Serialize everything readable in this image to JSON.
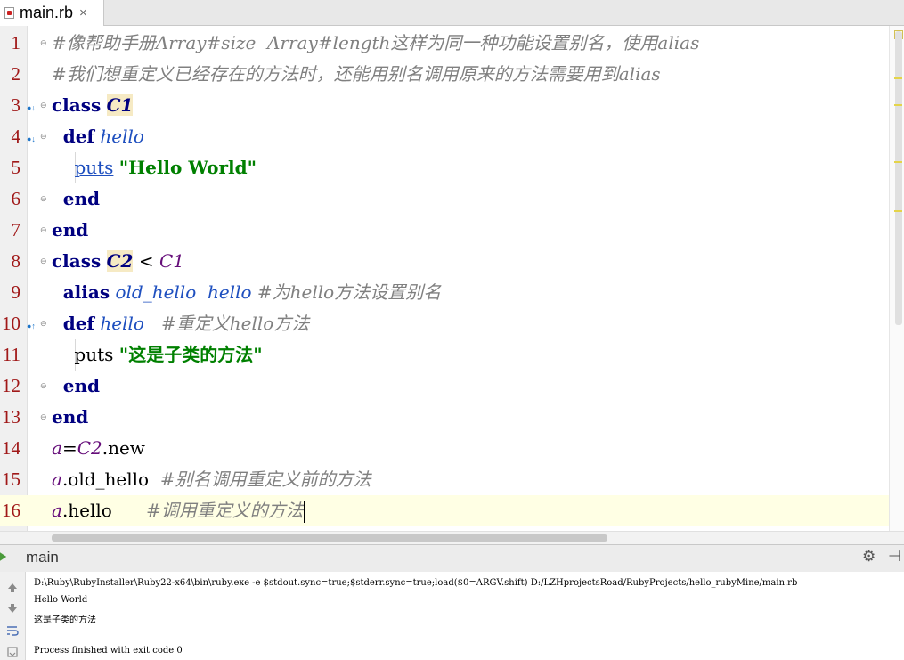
{
  "tab": {
    "file_name": "main.rb",
    "close_glyph": "×"
  },
  "editor": {
    "current_line": 16,
    "lines": [
      {
        "num": "1",
        "code": "#像帮助手册Array#size  Array#length这样为同一种功能设置别名，使用alias"
      },
      {
        "num": "2",
        "code": "#我们想重定义已经存在的方法时，还能用别名调用原来的方法需要用到alias"
      },
      {
        "num": "3",
        "code": "class C1"
      },
      {
        "num": "4",
        "code": "  def hello"
      },
      {
        "num": "5",
        "code": "    puts \"Hello World\""
      },
      {
        "num": "6",
        "code": "  end"
      },
      {
        "num": "7",
        "code": "end"
      },
      {
        "num": "8",
        "code": "class C2 < C1"
      },
      {
        "num": "9",
        "code": "  alias old_hello  hello #为hello方法设置别名"
      },
      {
        "num": "10",
        "code": "  def hello   #重定义hello方法"
      },
      {
        "num": "11",
        "code": "    puts \"这是子类的方法\""
      },
      {
        "num": "12",
        "code": "  end"
      },
      {
        "num": "13",
        "code": "end"
      },
      {
        "num": "14",
        "code": "a=C2.new"
      },
      {
        "num": "15",
        "code": "a.old_hello  #别名调用重定义前的方法"
      },
      {
        "num": "16",
        "code": "a.hello      #调用重定义的方法"
      }
    ]
  },
  "run_panel": {
    "title": "main",
    "gear_glyph": "⚙",
    "pin_glyph": "⊣",
    "toolbar_icons": [
      "arrow-up-icon",
      "arrow-down-icon",
      "soft-wrap-icon",
      "scroll-end-icon"
    ],
    "output": [
      "D:\\Ruby\\RubyInstaller\\Ruby22-x64\\bin\\ruby.exe -e $stdout.sync=true;$stderr.sync=true;load($0=ARGV.shift) D:/LZHprojectsRoad/RubyProjects/hello_rubyMine/main.rb",
      "Hello World",
      "这是子类的方法",
      "",
      "Process finished with exit code 0"
    ]
  },
  "colors": {
    "keyword": "#000080",
    "string": "#008000",
    "comment": "#808080",
    "line_number": "#a01818",
    "current_line_bg": "#ffffe4"
  }
}
